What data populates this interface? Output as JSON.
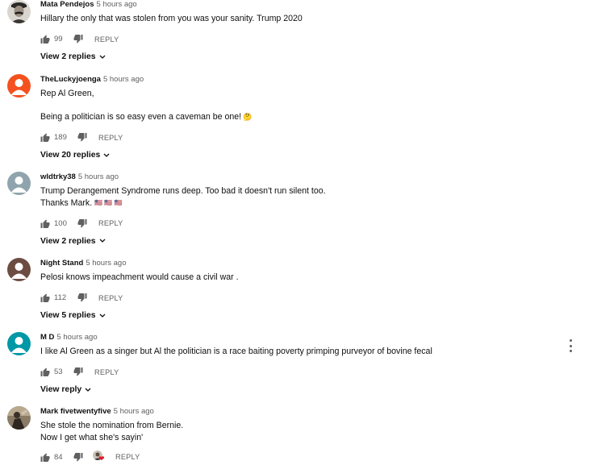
{
  "colors": {
    "text_primary": "#0f0f0f",
    "text_secondary": "#606060",
    "heart": "#e0162b"
  },
  "labels": {
    "reply": "REPLY"
  },
  "comments": [
    {
      "author": "Mata Pendejos",
      "time": "5 hours ago",
      "avatar_icon": "mustached-man-avatar-icon",
      "text": [
        "Hillary the only that was stolen from you was your sanity. Trump 2020"
      ],
      "likes": "99",
      "replies_label": "View 2 replies"
    },
    {
      "author": "TheLuckyjoenga",
      "time": "5 hours ago",
      "avatar_icon": "orange-default-avatar-icon",
      "avatar_color": "#f4511e",
      "text": [
        "Rep Al Green,",
        "",
        "Being a politician is so easy even a caveman be one!"
      ],
      "emoji": "🤔",
      "likes": "189",
      "replies_label": "View 20 replies"
    },
    {
      "author": "wldtrky38",
      "time": "5 hours ago",
      "avatar_icon": "gray-default-avatar-icon",
      "avatar_color": "#90a4ae",
      "text": [
        "Trump Derangement Syndrome runs deep. Too bad it doesn't run silent too.",
        "Thanks Mark."
      ],
      "flags": "🇺🇸 🇺🇸 🇺🇸",
      "likes": "100",
      "replies_label": "View 2 replies"
    },
    {
      "author": "Night Stand",
      "time": "5 hours ago",
      "avatar_icon": "brown-default-avatar-icon",
      "avatar_color": "#6d4c41",
      "text": [
        "Pelosi knows impeachment would cause a civil war ."
      ],
      "likes": "112",
      "replies_label": "View 5 replies"
    },
    {
      "author": "M D",
      "time": "5 hours ago",
      "avatar_icon": "teal-default-avatar-icon",
      "avatar_color": "#0097a7",
      "text": [
        "I like Al Green as a singer but Al the politician is a race baiting poverty primping purveyor of bovine fecal"
      ],
      "likes": "53",
      "replies_label": "View reply"
    },
    {
      "author": "Mark fivetwentyfive",
      "time": "5 hours ago",
      "avatar_icon": "photo-avatar-icon",
      "text": [
        "She stole the nomination from Bernie.",
        "Now I get what she's sayin'"
      ],
      "likes": "84",
      "creator_hearted": true
    }
  ]
}
